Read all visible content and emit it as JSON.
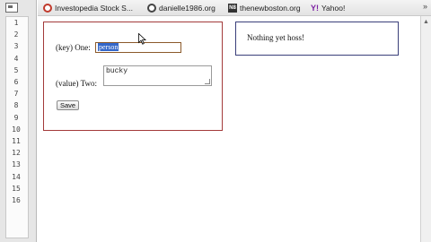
{
  "gutter": {
    "line_numbers": [
      "1",
      "2",
      "3",
      "4",
      "5",
      "6",
      "7",
      "8",
      "9",
      "10",
      "11",
      "12",
      "13",
      "14",
      "15",
      "16"
    ]
  },
  "bookmarks": {
    "items": [
      {
        "label": "Investopedia Stock S...",
        "icon": "investopedia-icon"
      },
      {
        "label": "danielle1986.org",
        "icon": "danielle-icon"
      },
      {
        "label": "thenewboston.org",
        "icon": "thenewboston-icon",
        "icon_text": "N8"
      },
      {
        "label": "Yahoo!",
        "icon": "yahoo-icon",
        "icon_text": "Y!"
      }
    ],
    "overflow": "»"
  },
  "form": {
    "key_label": "(key) One:",
    "key_value": "person",
    "value_label": "(value) Two:",
    "value_text": "bucky",
    "save_label": "Save"
  },
  "output": {
    "text": "Nothing yet hoss!"
  },
  "colors": {
    "form_border": "#a33a3a",
    "output_border": "#3a3f7a",
    "selection": "#3467c9"
  }
}
